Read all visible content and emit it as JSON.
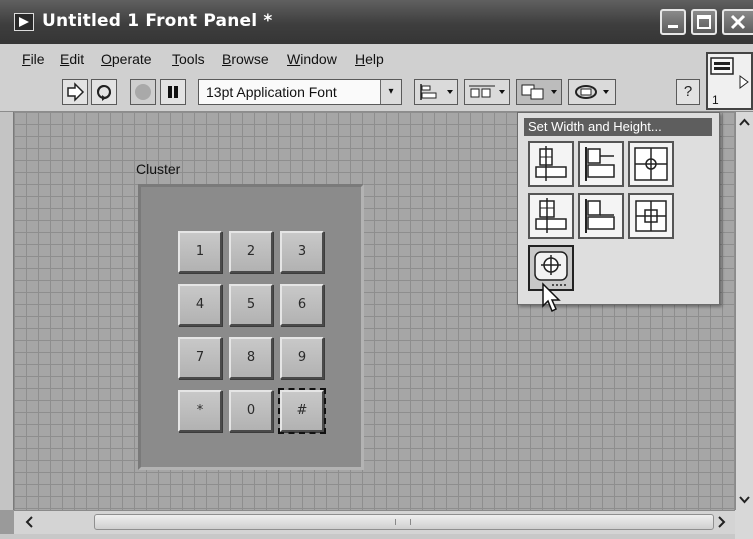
{
  "window": {
    "title": "Untitled 1 Front Panel *",
    "controls": [
      "minimize",
      "maximize",
      "close"
    ]
  },
  "menu": {
    "items": [
      {
        "mnemonic": "F",
        "rest": "ile"
      },
      {
        "mnemonic": "E",
        "rest": "dit"
      },
      {
        "mnemonic": "O",
        "rest": "perate"
      },
      {
        "mnemonic": "T",
        "rest": "ools"
      },
      {
        "mnemonic": "B",
        "rest": "rowse"
      },
      {
        "mnemonic": "W",
        "rest": "indow"
      },
      {
        "mnemonic": "H",
        "rest": "elp"
      }
    ]
  },
  "toolbar": {
    "font": "13pt Application Font",
    "dropdown_arrow": "▾",
    "help": "?"
  },
  "connector": {
    "number": "1"
  },
  "cluster": {
    "label": "Cluster",
    "keys": [
      "1",
      "2",
      "3",
      "4",
      "5",
      "6",
      "7",
      "8",
      "9",
      "*",
      "0",
      "#"
    ]
  },
  "palette": {
    "title": "Set Width and Height..."
  },
  "icons": {
    "title_icon": "front-panel-icon",
    "run": "run-arrow-icon",
    "run_continuous": "run-continuously-icon",
    "abort": "abort-icon",
    "pause": "pause-icon",
    "align": "align-objects-icon",
    "distribute": "distribute-objects-icon",
    "resize": "resize-objects-icon",
    "reorder": "reorder-icon"
  }
}
